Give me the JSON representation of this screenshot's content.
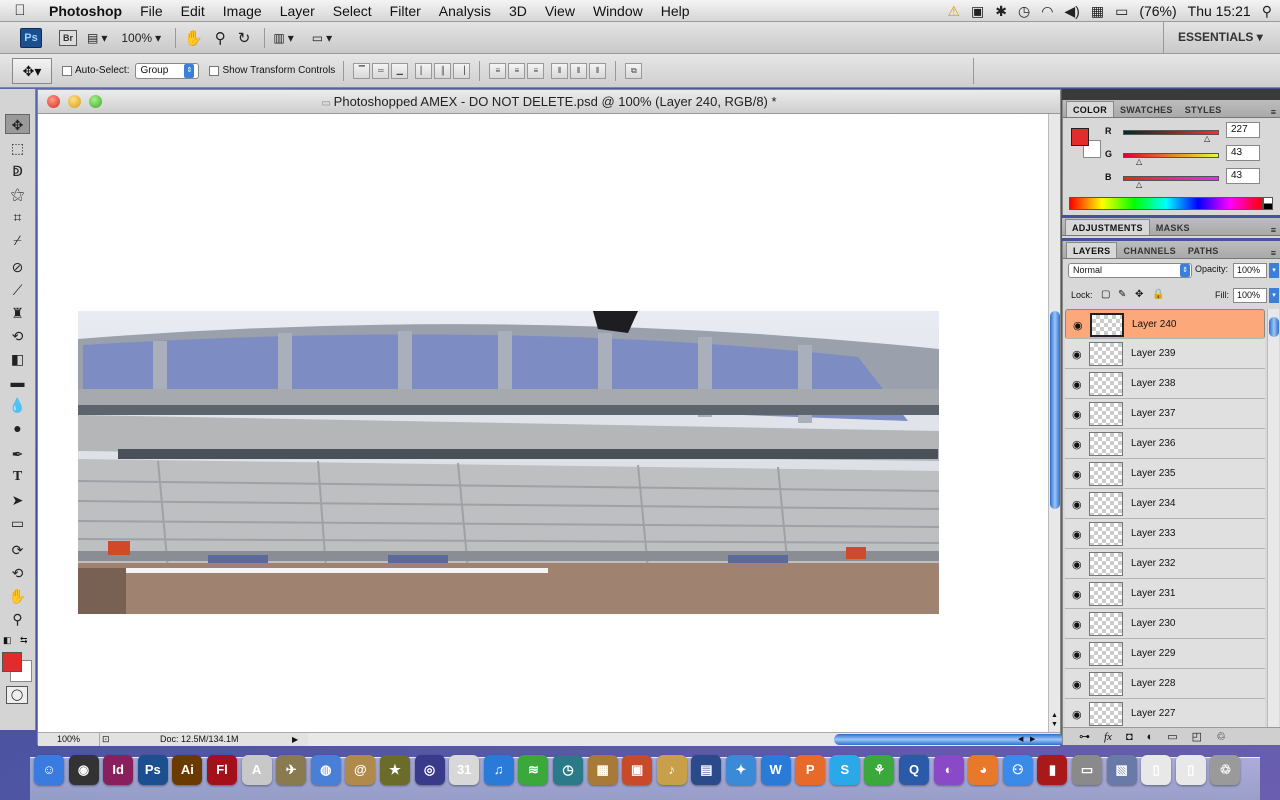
{
  "menubar": {
    "app_name": "Photoshop",
    "items": [
      "File",
      "Edit",
      "Image",
      "Layer",
      "Select",
      "Filter",
      "Analysis",
      "3D",
      "View",
      "Window",
      "Help"
    ],
    "battery": "(76%)",
    "clock": "Thu 15:21"
  },
  "appbar": {
    "ps_label": "Ps",
    "br_label": "Br",
    "zoom": "100%",
    "workspace": "ESSENTIALS"
  },
  "options": {
    "auto_select_label": "Auto-Select:",
    "auto_select_value": "Group",
    "show_transform_label": "Show Transform Controls"
  },
  "document": {
    "title": "Photoshopped AMEX - DO NOT DELETE.psd @ 100% (Layer 240, RGB/8) *",
    "status_zoom": "100%",
    "doc_size": "Doc: 12.5M/134.1M"
  },
  "color_panel": {
    "tabs": [
      "COLOR",
      "SWATCHES",
      "STYLES"
    ],
    "r_label": "R",
    "g_label": "G",
    "b_label": "B",
    "r": "227",
    "g": "43",
    "b": "43",
    "fg_color": "#e32b2b",
    "bg_color": "#ffffff"
  },
  "adjust_panel": {
    "tabs": [
      "ADJUSTMENTS",
      "MASKS"
    ]
  },
  "layers_panel": {
    "tabs": [
      "LAYERS",
      "CHANNELS",
      "PATHS"
    ],
    "blend_mode": "Normal",
    "opacity_label": "Opacity:",
    "opacity": "100%",
    "lock_label": "Lock:",
    "fill_label": "Fill:",
    "fill": "100%",
    "layers": [
      "Layer 240",
      "Layer 239",
      "Layer 238",
      "Layer 237",
      "Layer 236",
      "Layer 235",
      "Layer 234",
      "Layer 233",
      "Layer 232",
      "Layer 231",
      "Layer 230",
      "Layer 229",
      "Layer 228",
      "Layer 227"
    ],
    "selected_layer": "Layer 240"
  },
  "colors": {
    "selected_layer": "#fca87a",
    "scroll_accent": "#2c6ed0"
  },
  "dock_apps": [
    {
      "label": "Finder",
      "glyph": "☺",
      "color": "#3a7be0"
    },
    {
      "label": "Dashboard",
      "glyph": "◉",
      "color": "#333333"
    },
    {
      "label": "InDesign",
      "glyph": "Id",
      "color": "#8a1f5e"
    },
    {
      "label": "Photoshop",
      "glyph": "Ps",
      "color": "#1c4f8f"
    },
    {
      "label": "Illustrator",
      "glyph": "Ai",
      "color": "#6b3a00"
    },
    {
      "label": "Flash",
      "glyph": "Fl",
      "color": "#a3101a"
    },
    {
      "label": "Acrobat",
      "glyph": "A",
      "color": "#c8c8c8"
    },
    {
      "label": "Preview",
      "glyph": "✈",
      "color": "#8a7a50"
    },
    {
      "label": "iChat",
      "glyph": "◍",
      "color": "#4a7fd8"
    },
    {
      "label": "Address Book",
      "glyph": "@",
      "color": "#b08a4a"
    },
    {
      "label": "iMovie",
      "glyph": "★",
      "color": "#6b6b2a"
    },
    {
      "label": "DVD Player",
      "glyph": "◎",
      "color": "#3a3a8a"
    },
    {
      "label": "iCal",
      "glyph": "31",
      "color": "#d8d8d8"
    },
    {
      "label": "iTunes",
      "glyph": "♫",
      "color": "#2a7ad8"
    },
    {
      "label": "Spotify",
      "glyph": "≋",
      "color": "#3aa83a"
    },
    {
      "label": "Time Machine",
      "glyph": "◷",
      "color": "#2a7a8a"
    },
    {
      "label": "iPhoto",
      "glyph": "▦",
      "color": "#a87a3a"
    },
    {
      "label": "Photo Booth",
      "glyph": "▣",
      "color": "#c84a2a"
    },
    {
      "label": "GarageBand",
      "glyph": "♪",
      "color": "#c8a04a"
    },
    {
      "label": "Dashboard Widgets",
      "glyph": "▤",
      "color": "#2a4a8a"
    },
    {
      "label": "Safari",
      "glyph": "✦",
      "color": "#3a8ad8"
    },
    {
      "label": "Dreamweaver",
      "glyph": "W",
      "color": "#2a7ad8"
    },
    {
      "label": "Fireworks",
      "glyph": "P",
      "color": "#e86a2a"
    },
    {
      "label": "Skype",
      "glyph": "S",
      "color": "#2aa8e8"
    },
    {
      "label": "Tweetdeck",
      "glyph": "⚘",
      "color": "#3aa83a"
    },
    {
      "label": "QuickTime",
      "glyph": "Q",
      "color": "#2a5aa8"
    },
    {
      "label": "Growl",
      "glyph": "◐",
      "color": "#8a4ac8"
    },
    {
      "label": "Firefox",
      "glyph": "◕",
      "color": "#e8782a"
    },
    {
      "label": "MSN",
      "glyph": "⚇",
      "color": "#3a8ae8"
    },
    {
      "label": "Book",
      "glyph": "▮",
      "color": "#a81a1a"
    },
    {
      "label": "Media",
      "glyph": "▭",
      "color": "#8a8a8a"
    },
    {
      "label": "Photos",
      "glyph": "▧",
      "color": "#6a7aa8"
    },
    {
      "label": "Document",
      "glyph": "▯",
      "color": "#e8e8e8"
    },
    {
      "label": "Document 2",
      "glyph": "▯",
      "color": "#e8e8e8"
    },
    {
      "label": "Trash",
      "glyph": "♲",
      "color": "#9a9a9a"
    }
  ]
}
